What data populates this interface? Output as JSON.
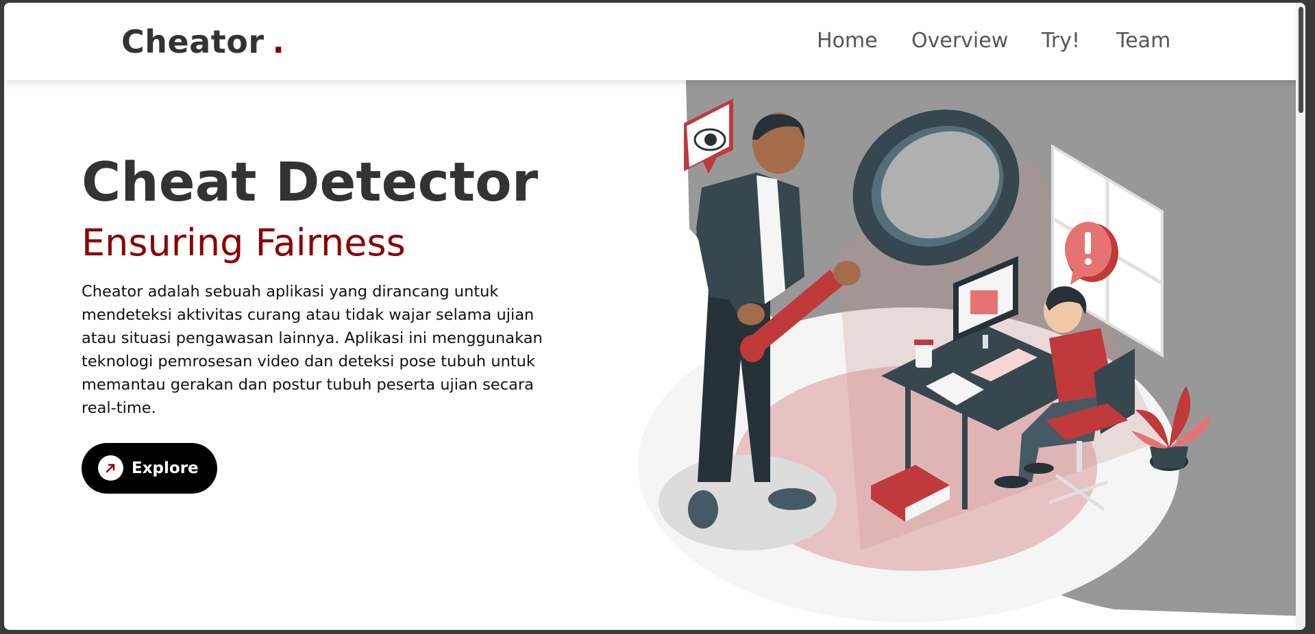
{
  "navbar": {
    "brand": "Cheator",
    "brand_dot": ".",
    "links": [
      "Home",
      "Overview",
      "Try!",
      "Team"
    ]
  },
  "hero": {
    "title": "Cheat Detector",
    "subtitle": "Ensuring Fairness",
    "description": "Cheator adalah sebuah aplikasi yang dirancang untuk mendeteksi aktivitas curang atau tidak wajar selama ujian atau situasi pengawasan lainnya. Aplikasi ini menggunakan teknologi pemrosesan video dan deteksi pose tubuh untuk memantau gerakan dan postur tubuh peserta ujian secara real-time.",
    "button_label": "Explore",
    "button_icon": "arrow-up-right-icon"
  },
  "illustration": {
    "subject": "inspector-with-magnifier-watching-student-at-desk",
    "icons": [
      "eye-icon",
      "exclamation-icon"
    ]
  },
  "colors": {
    "accent": "#8b0000",
    "brand_text": "#333333",
    "illustration_red": "#c0393b",
    "illustration_dark": "#37474f"
  }
}
